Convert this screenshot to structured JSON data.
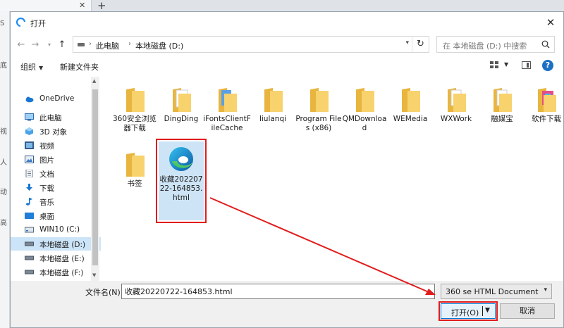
{
  "background": {
    "tab_close": "✕",
    "new_tab": "+",
    "left_chips": [
      "S",
      "底",
      "视",
      "人",
      "动",
      "高"
    ]
  },
  "dialog": {
    "title": "打开",
    "close": "✕"
  },
  "address": {
    "crumbs": [
      "此电脑",
      "本地磁盘 (D:)"
    ],
    "separator": "›",
    "search_placeholder": "在 本地磁盘 (D:) 中搜索"
  },
  "toolbar": {
    "organize": "组织",
    "new_folder": "新建文件夹",
    "help": "?"
  },
  "nav": {
    "items": [
      {
        "label": "OneDrive",
        "icon": "cloud-icon"
      },
      {
        "label": "此电脑",
        "icon": "computer-icon"
      },
      {
        "label": "3D 对象",
        "icon": "cube-icon"
      },
      {
        "label": "视频",
        "icon": "video-icon"
      },
      {
        "label": "图片",
        "icon": "picture-icon"
      },
      {
        "label": "文档",
        "icon": "document-icon"
      },
      {
        "label": "下载",
        "icon": "download-icon"
      },
      {
        "label": "音乐",
        "icon": "music-icon"
      },
      {
        "label": "桌面",
        "icon": "desktop-icon"
      },
      {
        "label": "WIN10 (C:)",
        "icon": "drive-icon"
      },
      {
        "label": "本地磁盘 (D:)",
        "icon": "drive-icon"
      },
      {
        "label": "本地磁盘 (E:)",
        "icon": "drive-icon"
      },
      {
        "label": "本地磁盘 (F:)",
        "icon": "drive-icon"
      },
      {
        "label": "网络",
        "icon": "network-icon"
      }
    ],
    "selected": "本地磁盘 (D:)"
  },
  "files": [
    {
      "label": "360安全浏览器下载",
      "kind": "folder"
    },
    {
      "label": "DingDing",
      "kind": "folder"
    },
    {
      "label": "iFontsClientFileCache",
      "kind": "folder"
    },
    {
      "label": "liulanqi",
      "kind": "folder"
    },
    {
      "label": "Program Files (x86)",
      "kind": "folder"
    },
    {
      "label": "QMDownload",
      "kind": "folder"
    },
    {
      "label": "WEMedia",
      "kind": "folder"
    },
    {
      "label": "WXWork",
      "kind": "folder"
    },
    {
      "label": "融媒宝",
      "kind": "folder"
    },
    {
      "label": "软件下载",
      "kind": "folder"
    },
    {
      "label": "书签",
      "kind": "folder"
    },
    {
      "label": "收藏20220722-164853.html",
      "kind": "edge-html"
    }
  ],
  "bottom": {
    "filename_label": "文件名(N):",
    "filename_value": "收藏20220722-164853.html",
    "filter": "360 se HTML Document",
    "open": "打开(O)",
    "cancel": "取消"
  },
  "colors": {
    "annotation": "#e21c1c",
    "selection": "#cce4f7",
    "accent": "#0078d7",
    "folder": "#f3c65a"
  }
}
